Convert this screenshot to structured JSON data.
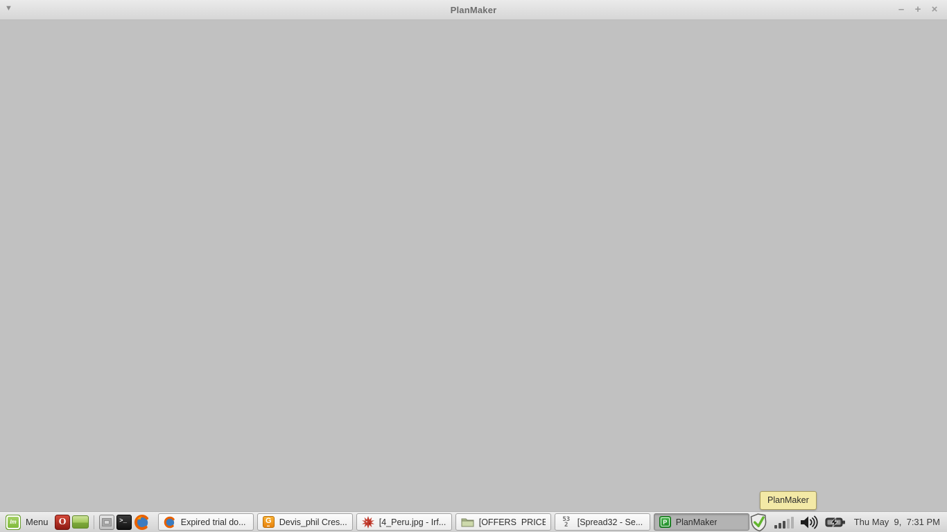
{
  "window": {
    "title": "PlanMaker",
    "controls": {
      "minimize": "–",
      "maximize": "+",
      "close": "×"
    }
  },
  "tooltip": {
    "text": "PlanMaker"
  },
  "taskbar": {
    "menu_label": "Menu",
    "launchers": [
      {
        "name": "menu",
        "icon": "linux-mint-logo-icon"
      },
      {
        "name": "opera",
        "icon": "opera-icon"
      },
      {
        "name": "show-desktop",
        "icon": "show-desktop-icon"
      },
      {
        "name": "computer",
        "icon": "computer-icon"
      },
      {
        "name": "terminal",
        "icon": "terminal-icon"
      },
      {
        "name": "firefox",
        "icon": "firefox-icon"
      }
    ],
    "windows": [
      {
        "label": "Expired trial do...",
        "icon": "firefox-icon",
        "active": false
      },
      {
        "label": "Devis_phil Cres...",
        "icon": "g-document-icon",
        "active": false
      },
      {
        "label": "[4_Peru.jpg - Irf...",
        "icon": "irfanview-icon",
        "active": false
      },
      {
        "label": "[OFFERS  PRICES]",
        "icon": "folder-icon",
        "active": false
      },
      {
        "label": "[Spread32 - Se...",
        "icon": "spread32-icon",
        "active": false
      },
      {
        "label": "PlanMaker",
        "icon": "planmaker-icon",
        "active": true
      }
    ],
    "tray": {
      "icons": [
        "update-shield-check-icon",
        "network-signal-icon",
        "volume-icon",
        "battery-icon"
      ],
      "clock": "Thu May  9,  7:31 PM"
    }
  },
  "icon_glyphs": {
    "window_menu": "▼",
    "mint": "lm",
    "opera": "O",
    "terminal": ">_",
    "gdoc": "G",
    "spread_top": "53",
    "spread_bottom": "2",
    "planmaker": "P"
  },
  "colors": {
    "content_bg": "#c1c1c1",
    "planmaker_green": "#2f9e33",
    "mint_green": "#8bc34a",
    "opera_red": "#b0231a",
    "tooltip_yellow": "#f3e9a6",
    "check_green": "#62b52e"
  }
}
